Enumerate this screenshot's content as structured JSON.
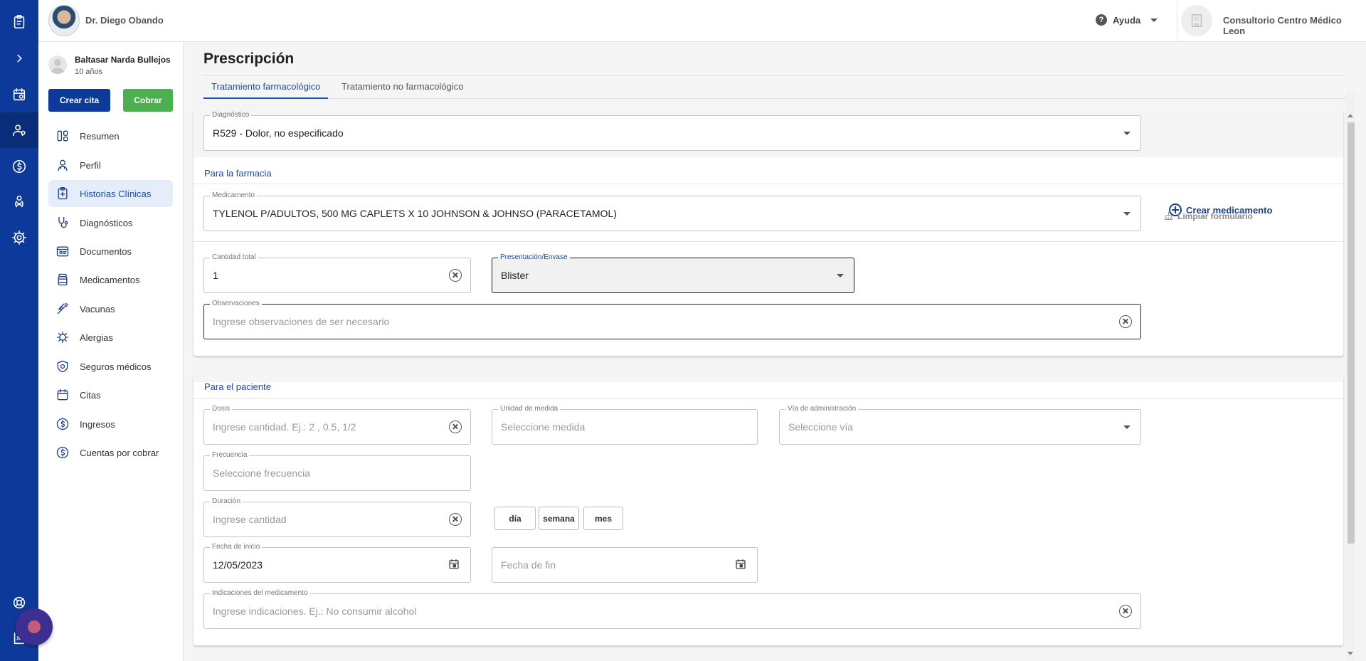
{
  "topbar": {
    "doctor_name": "Dr. Diego Obando",
    "help_label": "Ayuda",
    "clinic_name": "Consultorio Centro Médico Leon"
  },
  "rail": {
    "icons": [
      "clipboard-icon",
      "chevron-right-icon",
      "calendar-icon",
      "patients-icon",
      "money-icon",
      "doctor-icon",
      "settings-icon",
      "support-icon",
      "logout-icon"
    ]
  },
  "patient": {
    "name": "Baltasar Narda Bullejos",
    "age": "10 años",
    "create_appointment_label": "Crear cita",
    "charge_label": "Cobrar"
  },
  "nav": {
    "items": [
      {
        "label": "Resumen",
        "icon": "summary-icon"
      },
      {
        "label": "Perfil",
        "icon": "profile-icon"
      },
      {
        "label": "Historias Clínicas",
        "icon": "clinical-history-icon",
        "active": true
      },
      {
        "label": "Diagnósticos",
        "icon": "stethoscope-icon"
      },
      {
        "label": "Documentos",
        "icon": "documents-icon"
      },
      {
        "label": "Medicamentos",
        "icon": "medication-icon"
      },
      {
        "label": "Vacunas",
        "icon": "syringe-icon"
      },
      {
        "label": "Alergias",
        "icon": "allergy-icon"
      },
      {
        "label": "Seguros médicos",
        "icon": "insurance-icon"
      },
      {
        "label": "Citas",
        "icon": "appointments-icon"
      },
      {
        "label": "Ingresos",
        "icon": "income-icon"
      },
      {
        "label": "Cuentas por cobrar",
        "icon": "receivables-icon"
      }
    ]
  },
  "main": {
    "title": "Prescripción",
    "tabs": [
      {
        "label": "Tratamiento farmacológico",
        "active": true
      },
      {
        "label": "Tratamiento no farmacológico"
      }
    ],
    "diagnosis": {
      "label": "Diagnóstico",
      "value": "R529 - Dolor, no especificado"
    },
    "pharmacy": {
      "section_label": "Para la farmacia",
      "medication": {
        "label": "Medicamento",
        "value": "TYLENOL P/ADULTOS, 500 MG CAPLETS X 10 JOHNSON & JOHNSO (PARACETAMOL)"
      },
      "create_medication_label": "Crear medicamento",
      "quantity": {
        "label": "Cantidad total",
        "value": "1"
      },
      "presentation": {
        "label": "Presentación/Envase",
        "value": "Blister"
      },
      "clear_form_label": "Limpiar formulario",
      "observations": {
        "label": "Observaciones",
        "placeholder": "Ingrese observaciones de ser necesario"
      }
    },
    "patient_section": {
      "section_label": "Para el paciente",
      "dose": {
        "label": "Dosis",
        "placeholder": "Ingrese cantidad. Ej.: 2 , 0.5, 1/2"
      },
      "unit": {
        "label": "Unidad de medida",
        "placeholder": "Seleccione medida"
      },
      "route": {
        "label": "Vía de administración",
        "placeholder": "Seleccione vía"
      },
      "frequency": {
        "label": "Frecuencia",
        "placeholder": "Seleccione frecuencia"
      },
      "duration": {
        "label": "Duración",
        "placeholder": "Ingrese cantidad"
      },
      "duration_units": [
        "día",
        "semana",
        "mes"
      ],
      "start_date": {
        "label": "Fecha de inicio",
        "value": "12/05/2023"
      },
      "end_date": {
        "placeholder": "Fecha de fin"
      },
      "indications": {
        "label": "Indicaciones del medicamento",
        "placeholder": "Ingrese indicaciones. Ej.: No consumir alcohol"
      }
    }
  }
}
